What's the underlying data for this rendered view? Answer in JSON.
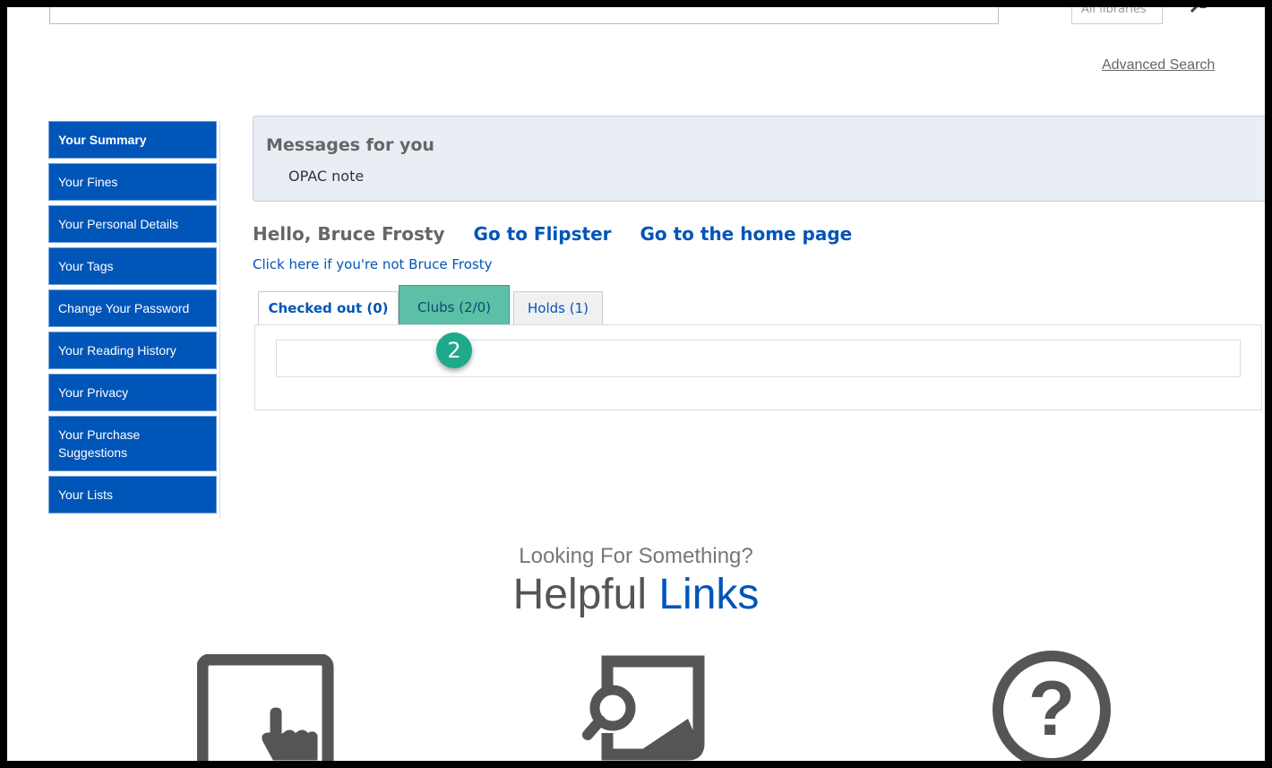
{
  "header": {
    "branch_select_value": "All libraries",
    "advanced_search_label": "Advanced Search"
  },
  "sidebar": {
    "items": [
      {
        "label": "Your Summary"
      },
      {
        "label": "Your Fines"
      },
      {
        "label": "Your Personal Details"
      },
      {
        "label": "Your Tags"
      },
      {
        "label": "Change Your Password"
      },
      {
        "label": "Your Reading History"
      },
      {
        "label": "Your Privacy"
      },
      {
        "label": "Your Purchase Suggestions"
      },
      {
        "label": "Your Lists"
      }
    ]
  },
  "messages": {
    "title": "Messages for you",
    "note": "OPAC note"
  },
  "greeting": {
    "hello": "Hello, Bruce Frosty",
    "flipster_link": "Go to Flipster",
    "home_link": "Go to the home page",
    "not_you_link": "Click here if you're not Bruce Frosty"
  },
  "tabs": [
    {
      "label": "Checked out (0)"
    },
    {
      "label": "Clubs (2/0)"
    },
    {
      "label": "Holds (1)"
    }
  ],
  "callout_badge": "2",
  "helpful": {
    "subtitle": "Looking For Something?",
    "title_main": "Helpful",
    "title_accent": "Links"
  },
  "colors": {
    "brand_blue": "#0055b8",
    "highlight_teal": "#5cc0a7",
    "badge_green": "#1fa98c"
  }
}
